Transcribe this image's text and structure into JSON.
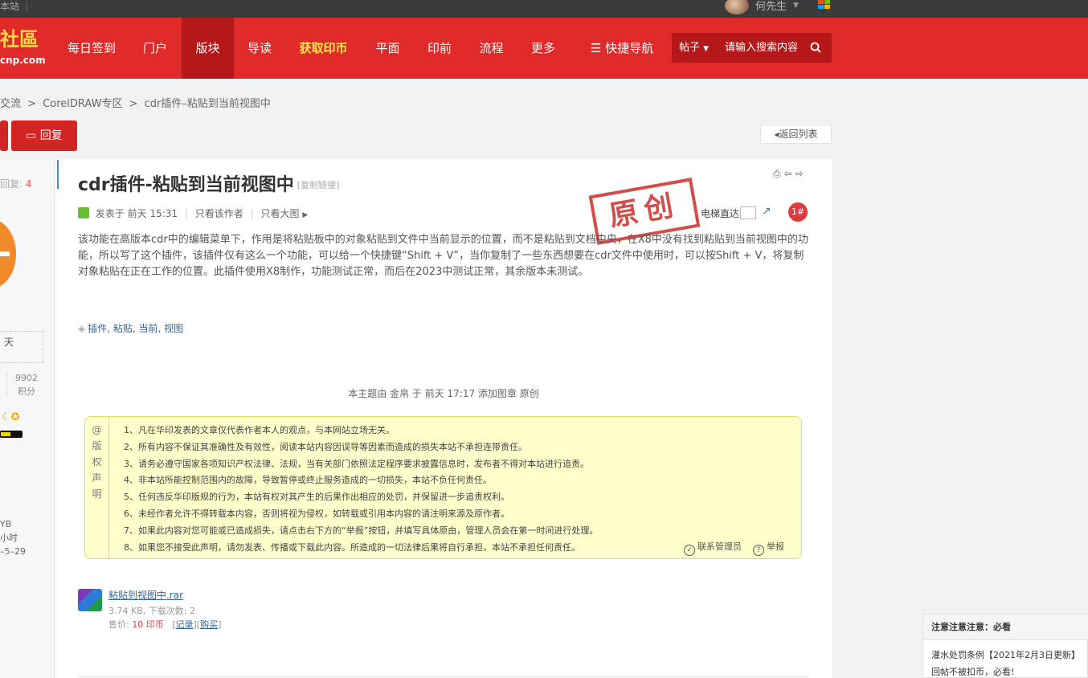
{
  "topbar": {
    "site_text": "本站",
    "user_name": "何先生"
  },
  "nav": {
    "logo_top": "社區",
    "logo_bottom": "cnp.com",
    "items": [
      "每日签到",
      "门户",
      "版块",
      "导读",
      "获取印币",
      "平面",
      "印前",
      "流程",
      "更多"
    ],
    "active_index": 2,
    "highlight_index": 4,
    "quick_nav": "快捷导航",
    "search_scope": "帖子",
    "search_placeholder": "请输入搜索内容"
  },
  "breadcrumb": [
    "交流",
    "CorelDRAW专区",
    "cdr插件–粘贴到当前视图中"
  ],
  "breadcrumb_sep": ">",
  "actions": {
    "reply": "回复",
    "back_list": "返回列表"
  },
  "sidebar": {
    "replies_label": "回复:",
    "replies_count": "4",
    "day_text": "天",
    "points_value": "9902",
    "points_label": "积分",
    "info_lines": [
      "YB",
      "小时",
      "–5–29"
    ]
  },
  "post": {
    "title": "cdr插件-粘贴到当前视图中",
    "copy_link": "[复制链接]",
    "posted_prefix": "发表于",
    "posted_time": "前天 15:31",
    "only_author": "只看该作者",
    "only_big_image": "只看大图",
    "stamp_text": "原创",
    "elevator_label": "电梯直达",
    "floor": "1#",
    "body": "该功能在高版本cdr中的编辑菜单下，作用是将粘贴板中的对象粘贴到文件中当前显示的位置，而不是粘贴到文档中央，在X8中没有找到粘贴到当前视图中的功能，所以写了这个插件，该插件仅有这么一个功能，可以给一个快捷键“Shift + V”，当你复制了一些东西想要在cdr文件中使用时，可以按Shift + V，将复制对象粘贴在正在工作的位置。此插件使用X8制作，功能测试正常，而后在2023中测试正常，其余版本未测试。",
    "tags": "插件, 粘贴, 当前, 视图",
    "mod_log": "本主题由 金帛 于 前天 17:17 添加图章 原创"
  },
  "notice": {
    "side_label": [
      "@",
      "版",
      "权",
      "声",
      "明"
    ],
    "lines": [
      "1、凡在华印发表的文章仅代表作者本人的观点，与本网站立场无关。",
      "2、所有内容不保证其准确性及有效性，阅读本站内容因误导等因素而造成的损失本站不承担连带责任。",
      "3、请务必遵守国家各项知识产权法律、法规，当有关部门依照法定程序要求披露信息时，发布者不得对本站进行追责。",
      "4、非本站所能控制范围内的故障，导致暂停或终止服务造成的一切损失，本站不负任何责任。",
      "5、任何违反华印版规的行为，本站有权对其产生的后果作出相应的处罚，并保留进一步追责权利。",
      "6、未经作者允许不得转载本内容，否则将视为侵权，如转载或引用本内容的请注明来源及原作者。",
      "7、如果此内容对您可能或已造成损失，请点击右下方的“举报”按钮，并填写具体原由，管理人员会在第一时间进行处理。",
      "8、如果您不接受此声明，请勿发表、传播或下载此内容。所造成的一切法律后果将自行承担，本站不承担任何责任。"
    ],
    "contact_admin": "联系管理员",
    "report": "举报"
  },
  "attachment": {
    "file_name": "粘贴到视图中.rar",
    "size_line": "3.74 KB, 下载次数: 2",
    "price_label": "售价:",
    "price_value": "10 印币",
    "record": "记录",
    "buy": "购买"
  },
  "float_panel": {
    "title": "注意注意注意：必看",
    "line1": "灌水处罚条例【2021年2月3日更新】",
    "line2": "回帖不被扣币，必看!"
  },
  "colors": {
    "brand_red": "#e02a2a",
    "nav_active": "#b51818",
    "notice_bg": "#ffffcc",
    "link": "#336699"
  }
}
